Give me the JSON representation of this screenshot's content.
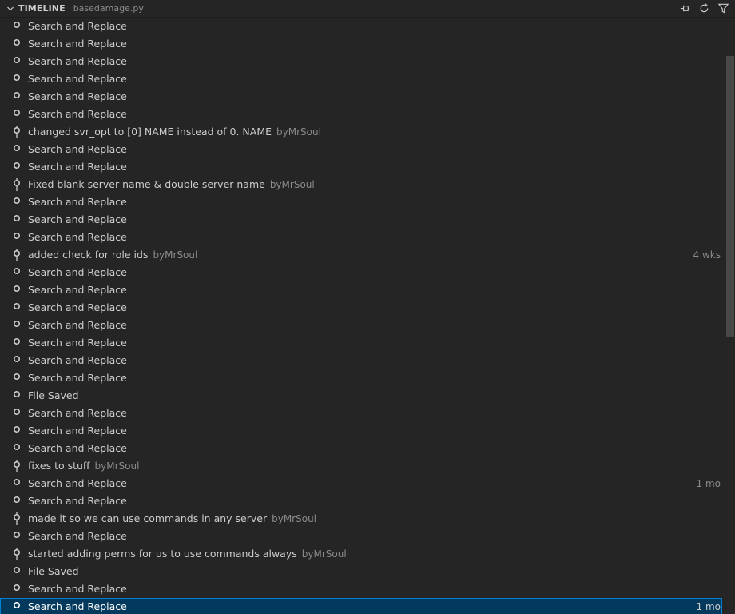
{
  "header": {
    "title": "TIMELINE",
    "file": "basedamage.py",
    "actions": [
      {
        "name": "pin-icon"
      },
      {
        "name": "refresh-icon"
      },
      {
        "name": "filter-icon"
      }
    ]
  },
  "colors": {
    "background": "#252526",
    "text": "#cccccc",
    "muted": "#8b8b8b",
    "selection": "#04395e",
    "selection_border": "#007fd4"
  },
  "items": [
    {
      "label": "Search and Replace",
      "kind": "save"
    },
    {
      "label": "Search and Replace",
      "kind": "save"
    },
    {
      "label": "Search and Replace",
      "kind": "save"
    },
    {
      "label": "Search and Replace",
      "kind": "save"
    },
    {
      "label": "Search and Replace",
      "kind": "save"
    },
    {
      "label": "Search and Replace",
      "kind": "save"
    },
    {
      "label": "changed svr_opt to [0] NAME instead of 0. NAME",
      "kind": "commit",
      "author": "byMrSoul"
    },
    {
      "label": "Search and Replace",
      "kind": "save"
    },
    {
      "label": "Search and Replace",
      "kind": "save"
    },
    {
      "label": "Fixed blank server name & double server name",
      "kind": "commit",
      "author": "byMrSoul"
    },
    {
      "label": "Search and Replace",
      "kind": "save"
    },
    {
      "label": "Search and Replace",
      "kind": "save"
    },
    {
      "label": "Search and Replace",
      "kind": "save"
    },
    {
      "label": "added check for role ids",
      "kind": "commit",
      "author": "byMrSoul",
      "when": "4 wks"
    },
    {
      "label": "Search and Replace",
      "kind": "save"
    },
    {
      "label": "Search and Replace",
      "kind": "save"
    },
    {
      "label": "Search and Replace",
      "kind": "save"
    },
    {
      "label": "Search and Replace",
      "kind": "save"
    },
    {
      "label": "Search and Replace",
      "kind": "save"
    },
    {
      "label": "Search and Replace",
      "kind": "save"
    },
    {
      "label": "Search and Replace",
      "kind": "save"
    },
    {
      "label": "File Saved",
      "kind": "save"
    },
    {
      "label": "Search and Replace",
      "kind": "save"
    },
    {
      "label": "Search and Replace",
      "kind": "save"
    },
    {
      "label": "Search and Replace",
      "kind": "save"
    },
    {
      "label": "fixes to stuff",
      "kind": "commit",
      "author": "byMrSoul"
    },
    {
      "label": "Search and Replace",
      "kind": "save",
      "when": "1 mo"
    },
    {
      "label": "Search and Replace",
      "kind": "save"
    },
    {
      "label": "made it so we can use commands in any server",
      "kind": "commit",
      "author": "byMrSoul"
    },
    {
      "label": "Search and Replace",
      "kind": "save"
    },
    {
      "label": "started adding perms for us to use commands always",
      "kind": "commit",
      "author": "byMrSoul"
    },
    {
      "label": "File Saved",
      "kind": "save"
    },
    {
      "label": "Search and Replace",
      "kind": "save"
    },
    {
      "label": "Search and Replace",
      "kind": "save",
      "when": "1 mo",
      "selected": true
    }
  ]
}
